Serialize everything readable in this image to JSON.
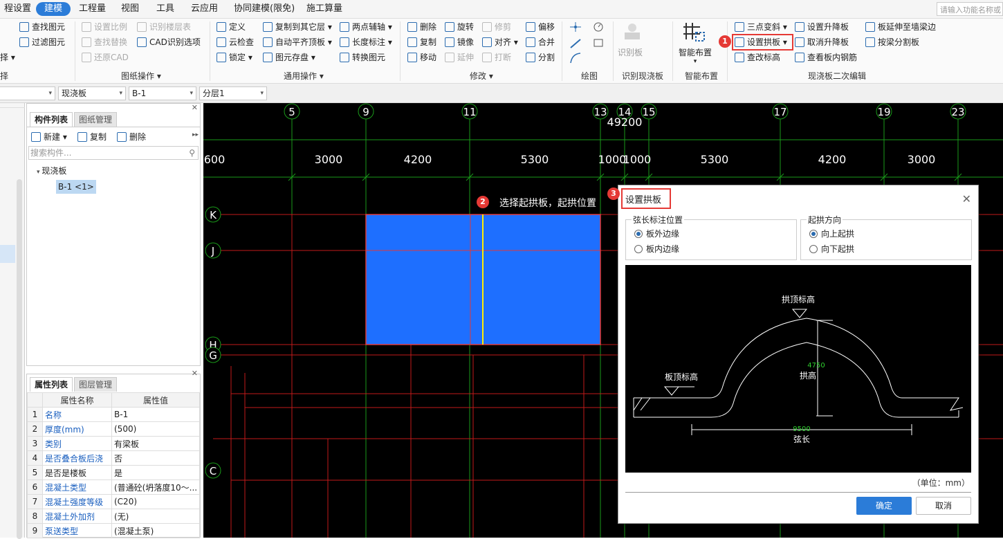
{
  "menu": {
    "items": [
      "程设置",
      "建模",
      "工程量",
      "视图",
      "工具",
      "云应用",
      "协同建模(限免)",
      "施工算量"
    ],
    "search_placeholder": "请输入功能名称或"
  },
  "ribbon": {
    "col0": [
      "查找图元",
      "过滤图元",
      "择"
    ],
    "col1": [
      "设置比例",
      "查找替换",
      "还原CAD"
    ],
    "col2": [
      "识别楼层表",
      "CAD识别选项"
    ],
    "group_cad": "图纸操作",
    "general_a": [
      "定义",
      "云检查",
      "锁定"
    ],
    "general_b": [
      "复制到其它层",
      "自动平齐顶板",
      "图元存盘"
    ],
    "general_c": [
      "两点辅轴",
      "长度标注",
      "转换图元"
    ],
    "group_general": "通用操作",
    "modify_a": [
      "删除",
      "复制",
      "移动"
    ],
    "modify_b": [
      "旋转",
      "镜像",
      "延伸"
    ],
    "modify_c": [
      "修剪",
      "对齐",
      "打断"
    ],
    "modify_d": [
      "偏移",
      "合并",
      "分割"
    ],
    "group_modify": "修改",
    "group_draw": "绘图",
    "recognize": "识别板",
    "group_recognize": "识别现浇板",
    "smart": "智能布置",
    "group_smart": "智能布置",
    "edit_a": [
      "三点变斜",
      "设置拱板",
      "查改标高"
    ],
    "edit_b": [
      "设置升降板",
      "取消升降板",
      "查看板内钢筋"
    ],
    "edit_c": [
      "板延伸至墙梁边",
      "按梁分割板"
    ],
    "group_edit": "现浇板二次编辑"
  },
  "propbar": {
    "type": "现浇板",
    "name": "B-1",
    "layer": "分层1"
  },
  "panel1": {
    "tab_active": "构件列表",
    "tab_other": "图纸管理",
    "new": "新建",
    "copy": "复制",
    "delete": "删除",
    "search_placeholder": "搜索构件...",
    "tree_root": "现浇板",
    "tree_item": "B-1 <1>"
  },
  "panel2": {
    "tab_active": "属性列表",
    "tab_other": "图层管理",
    "col_name": "属性名称",
    "col_value": "属性值",
    "rows": [
      {
        "n": "1",
        "name": "名称",
        "value": "B-1",
        "blue": true
      },
      {
        "n": "2",
        "name": "厚度(mm)",
        "value": "(500)",
        "blue": true
      },
      {
        "n": "3",
        "name": "类别",
        "value": "有梁板",
        "blue": true
      },
      {
        "n": "4",
        "name": "是否叠合板后浇",
        "value": "否",
        "blue": true
      },
      {
        "n": "5",
        "name": "是否是楼板",
        "value": "是",
        "blue": false
      },
      {
        "n": "6",
        "name": "混凝土类型",
        "value": "(普通砼(坍落度10～...",
        "blue": true
      },
      {
        "n": "7",
        "name": "混凝土强度等级",
        "value": "(C20)",
        "blue": true
      },
      {
        "n": "8",
        "name": "混凝土外加剂",
        "value": "(无)",
        "blue": true
      },
      {
        "n": "9",
        "name": "泵送类型",
        "value": "(混凝土泵)",
        "blue": true
      }
    ]
  },
  "canvas": {
    "axes_top": [
      "5",
      "9",
      "11",
      "13",
      "14",
      "15",
      "17",
      "19",
      "23"
    ],
    "dims": [
      "600",
      "3000",
      "4200",
      "5300",
      "1000",
      "1000",
      "5300",
      "4200",
      "3000"
    ],
    "dim_total": "49200",
    "axes_left": [
      "K",
      "J",
      "H",
      "G",
      "C"
    ],
    "hint": "选择起拱板，起拱位置"
  },
  "dialog": {
    "title": "设置拱板",
    "group_chord": "弦长标注位置",
    "opt_outer": "板外边缘",
    "opt_inner": "板内边缘",
    "group_dir": "起拱方向",
    "opt_up": "向上起拱",
    "opt_down": "向下起拱",
    "lbl_top": "拱顶标高",
    "lbl_slab": "板顶标高",
    "lbl_rise": "拱高",
    "lbl_chord": "弦长",
    "val_rise": "4750",
    "val_chord": "9500",
    "unit": "（单位：mm）",
    "ok": "确定",
    "cancel": "取消"
  },
  "badges": [
    "1",
    "2",
    "3"
  ],
  "colors": {
    "accent": "#2b7cd8",
    "slab": "#1e6fff",
    "grid_green": "#1a9a1a",
    "axis_red": "#d42020",
    "marker": "#e53935"
  }
}
